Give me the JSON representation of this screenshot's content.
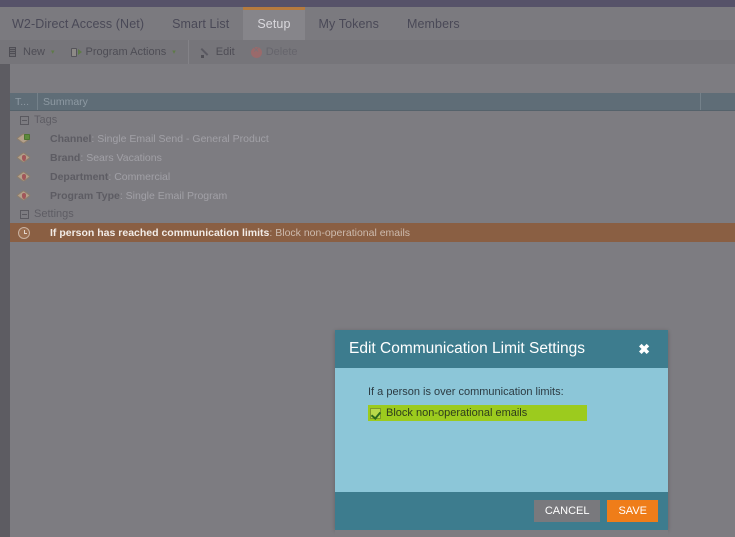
{
  "app": {
    "tabs": [
      {
        "label": "W2-Direct Access (Net)",
        "active": false
      },
      {
        "label": "Smart List",
        "active": false
      },
      {
        "label": "Setup",
        "active": true
      },
      {
        "label": "My Tokens",
        "active": false
      },
      {
        "label": "Members",
        "active": false
      }
    ]
  },
  "toolbar": {
    "items": [
      {
        "label": "New",
        "icon": "new-document-icon",
        "caret": "▾",
        "disabled": false
      },
      {
        "label": "Program Actions",
        "icon": "program-actions-icon",
        "caret": "▾",
        "disabled": false
      },
      {
        "label": "Edit",
        "icon": "pencil-icon",
        "caret": "",
        "disabled": false
      },
      {
        "label": "Delete",
        "icon": "delete-circle-icon",
        "caret": "",
        "disabled": true
      }
    ]
  },
  "grid": {
    "columns": [
      {
        "label": "T...",
        "key": "type"
      },
      {
        "label": "Summary",
        "key": "summary"
      },
      {
        "label": "",
        "key": "extra"
      }
    ],
    "groups": [
      {
        "label": "Tags",
        "rows": [
          {
            "icon": "tag-add-icon",
            "label": "Channel",
            "value": "Single Email Send - General Product",
            "selected": false
          },
          {
            "icon": "tag-icon",
            "label": "Brand",
            "value": "Sears Vacations",
            "selected": false
          },
          {
            "icon": "tag-icon",
            "label": "Department",
            "value": "Commercial",
            "selected": false
          },
          {
            "icon": "tag-icon",
            "label": "Program Type",
            "value": "Single Email Program",
            "selected": false
          }
        ]
      },
      {
        "label": "Settings",
        "rows": [
          {
            "icon": "communication-limit-icon",
            "label": "If person has reached communication limits",
            "value": "Block non-operational emails",
            "selected": true
          }
        ]
      }
    ]
  },
  "modal": {
    "title": "Edit Communication Limit Settings",
    "close_icon": "✖",
    "prompt": "If a person is over communication limits:",
    "checkbox": {
      "label": "Block non-operational emails",
      "checked": true
    },
    "cancel_label": "CANCEL",
    "save_label": "SAVE"
  },
  "colors": {
    "accent_orange": "#ef7d19",
    "modal_teal": "#3d7c8e",
    "modal_body_blue": "#8cc6d8",
    "highlight_green": "#9ccb1e",
    "selected_row": "#8a5f43",
    "grid_header": "#5f6d77"
  }
}
